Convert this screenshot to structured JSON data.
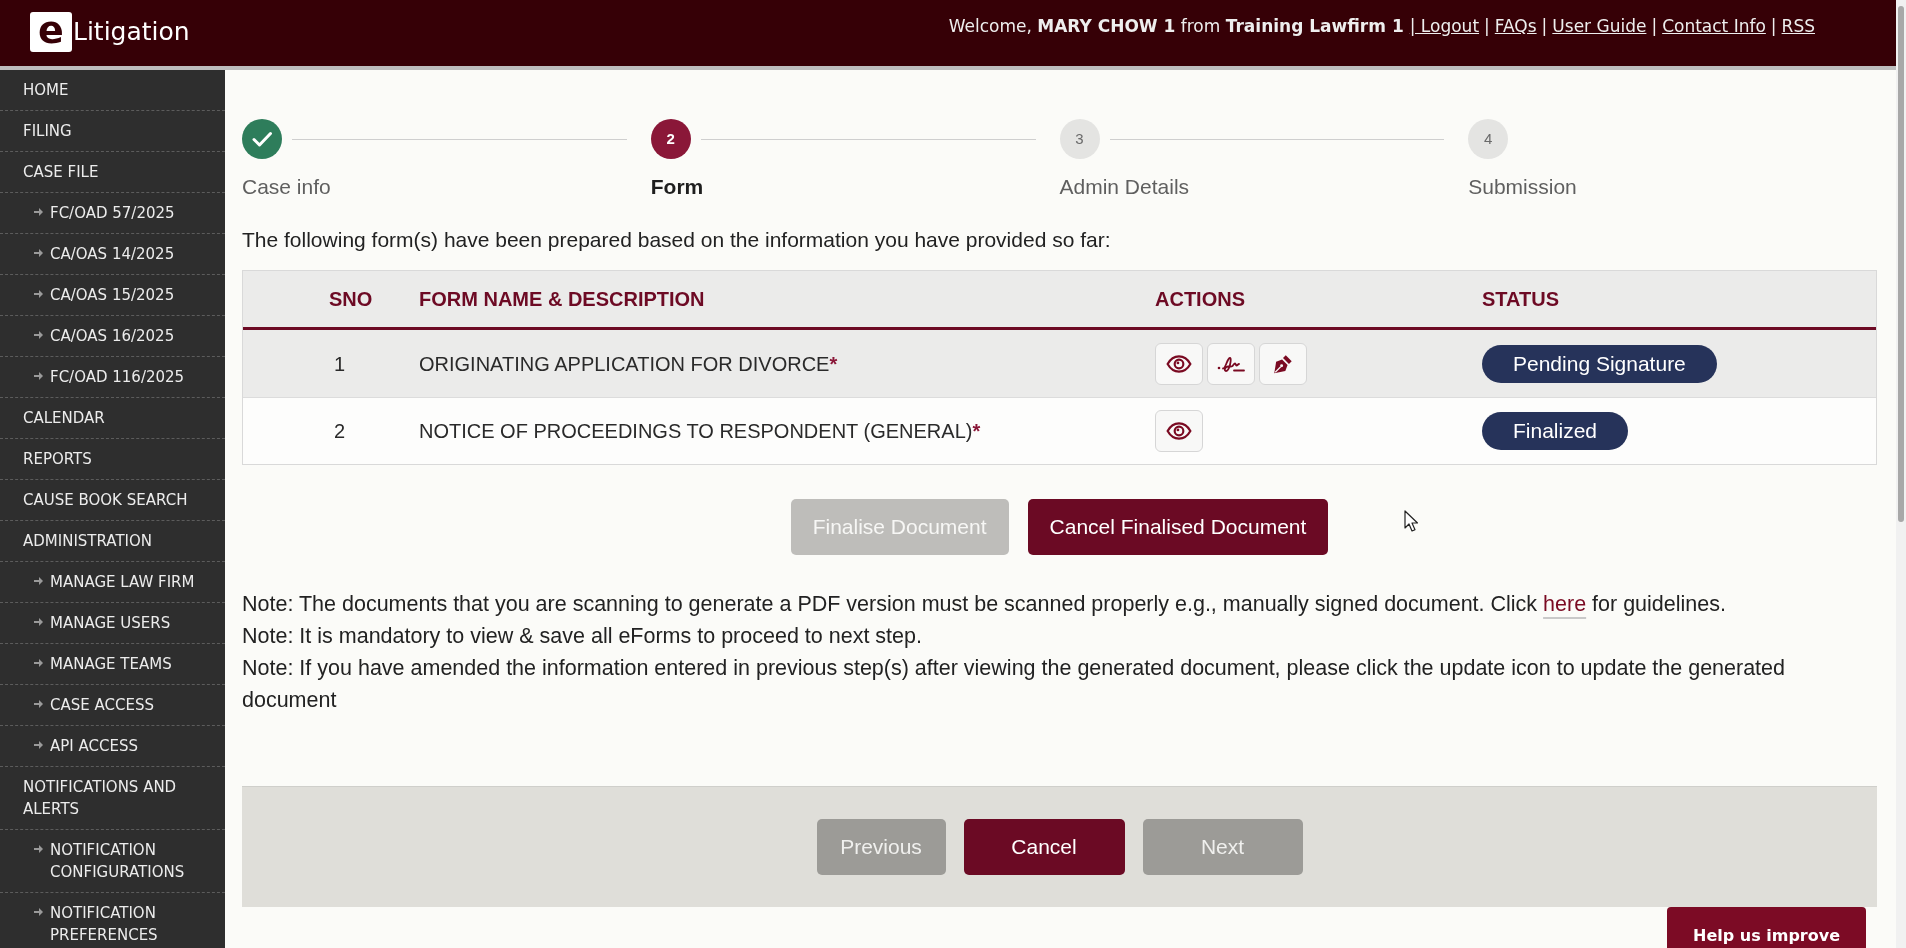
{
  "header": {
    "logo": {
      "mark": "e",
      "text": "Litigation"
    },
    "welcome": "Welcome, **MARY CHOW 1** from **Training Lawfirm 1**",
    "links": [
      {
        "label": "| Logout"
      },
      {
        "prefix": "|",
        "label": "FAQs"
      },
      {
        "prefix": "|",
        "label": "User Guide"
      },
      {
        "prefix": "|",
        "label": "Contact Info"
      },
      {
        "prefix": "|",
        "label": "RSS"
      }
    ]
  },
  "sidebar": {
    "items": [
      {
        "label": "HOME"
      },
      {
        "label": "FILING"
      },
      {
        "label": "CASE FILE",
        "children": [
          {
            "label": "FC/OAD 57/2025"
          },
          {
            "label": "CA/OAS 14/2025"
          },
          {
            "label": "CA/OAS 15/2025"
          },
          {
            "label": "CA/OAS 16/2025"
          },
          {
            "label": "FC/OAD 116/2025"
          }
        ]
      },
      {
        "label": "CALENDAR"
      },
      {
        "label": "REPORTS"
      },
      {
        "label": "CAUSE BOOK SEARCH"
      },
      {
        "label": "ADMINISTRATION",
        "children": [
          {
            "label": "MANAGE LAW FIRM"
          },
          {
            "label": "MANAGE USERS"
          },
          {
            "label": "MANAGE TEAMS"
          },
          {
            "label": "CASE ACCESS"
          },
          {
            "label": "API ACCESS"
          }
        ]
      },
      {
        "label": "NOTIFICATIONS AND ALERTS",
        "children": [
          {
            "label": "NOTIFICATION CONFIGURATIONS"
          },
          {
            "label": "NOTIFICATION PREFERENCES"
          }
        ]
      }
    ]
  },
  "stepper": {
    "steps": [
      {
        "label": "Case info",
        "completed": true,
        "selected": false
      },
      {
        "number": "2",
        "label": "Form",
        "completed": false,
        "selected": true
      },
      {
        "number": "3",
        "label": "Admin Details",
        "completed": false,
        "selected": false
      },
      {
        "number": "4",
        "label": "Submission",
        "completed": false,
        "selected": false
      }
    ]
  },
  "intro": "The following form(s) have been prepared based on the information you have provided so far:",
  "table": {
    "columns": [
      "SNO",
      "FORM NAME & DESCRIPTION",
      "ACTIONS",
      "STATUS"
    ],
    "rows": [
      {
        "sno": "1",
        "name": "ORIGINATING APPLICATION FOR DIVORCE",
        "required_mark": "*",
        "actions": [
          {
            "kind": "view"
          },
          {
            "kind": "sign"
          },
          {
            "kind": "pen"
          }
        ],
        "status": "Pending Signature"
      },
      {
        "sno": "2",
        "name": "NOTICE OF PROCEEDINGS TO RESPONDENT (GENERAL)",
        "required_mark": "*",
        "actions": [
          {
            "kind": "view"
          }
        ],
        "status": "Finalized"
      }
    ]
  },
  "document_buttons": [
    {
      "label": "Finalise Document",
      "disabled": true
    },
    {
      "label": "Cancel Finalised Document",
      "disabled": false
    }
  ],
  "notes": [
    {
      "text": "Note: The documents that you are scanning to generate a PDF version must be scanned properly e.g., manually signed document. Click",
      "link": "here",
      "text_after": "for guidelines."
    },
    {
      "text": "Note: It is mandatory to view & save all eForms to proceed to next step."
    },
    {
      "text": "Note: If you have amended the information entered in previous step(s) after viewing the generated document, please click the update icon to update the generated document"
    }
  ],
  "wizard_buttons": [
    {
      "label": "Previous",
      "disabled": true
    },
    {
      "label": "Cancel",
      "disabled": false
    },
    {
      "label": "Next",
      "disabled": true
    }
  ],
  "feedback_button": {
    "label": "Help us improve"
  }
}
